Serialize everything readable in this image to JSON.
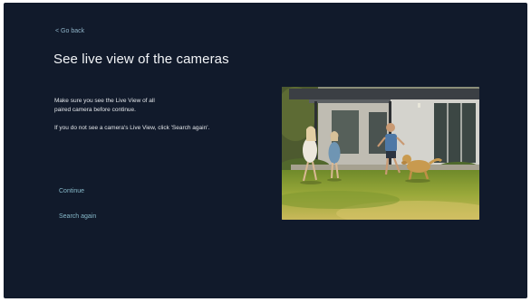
{
  "nav": {
    "back_label": "< Go back"
  },
  "page": {
    "title": "See live view of the cameras"
  },
  "instructions": {
    "line1": "Make sure you see the Live View of all",
    "line2": "paired camera before continue.",
    "line3": "If you do not see a camera's Live View, click 'Search again'."
  },
  "actions": {
    "continue_label": "Continue",
    "search_again_label": "Search again"
  },
  "colors": {
    "background": "#111a2b",
    "title_text": "#f2f4f7",
    "body_text": "#e3e6ea",
    "link_accent": "#86b8c9"
  }
}
